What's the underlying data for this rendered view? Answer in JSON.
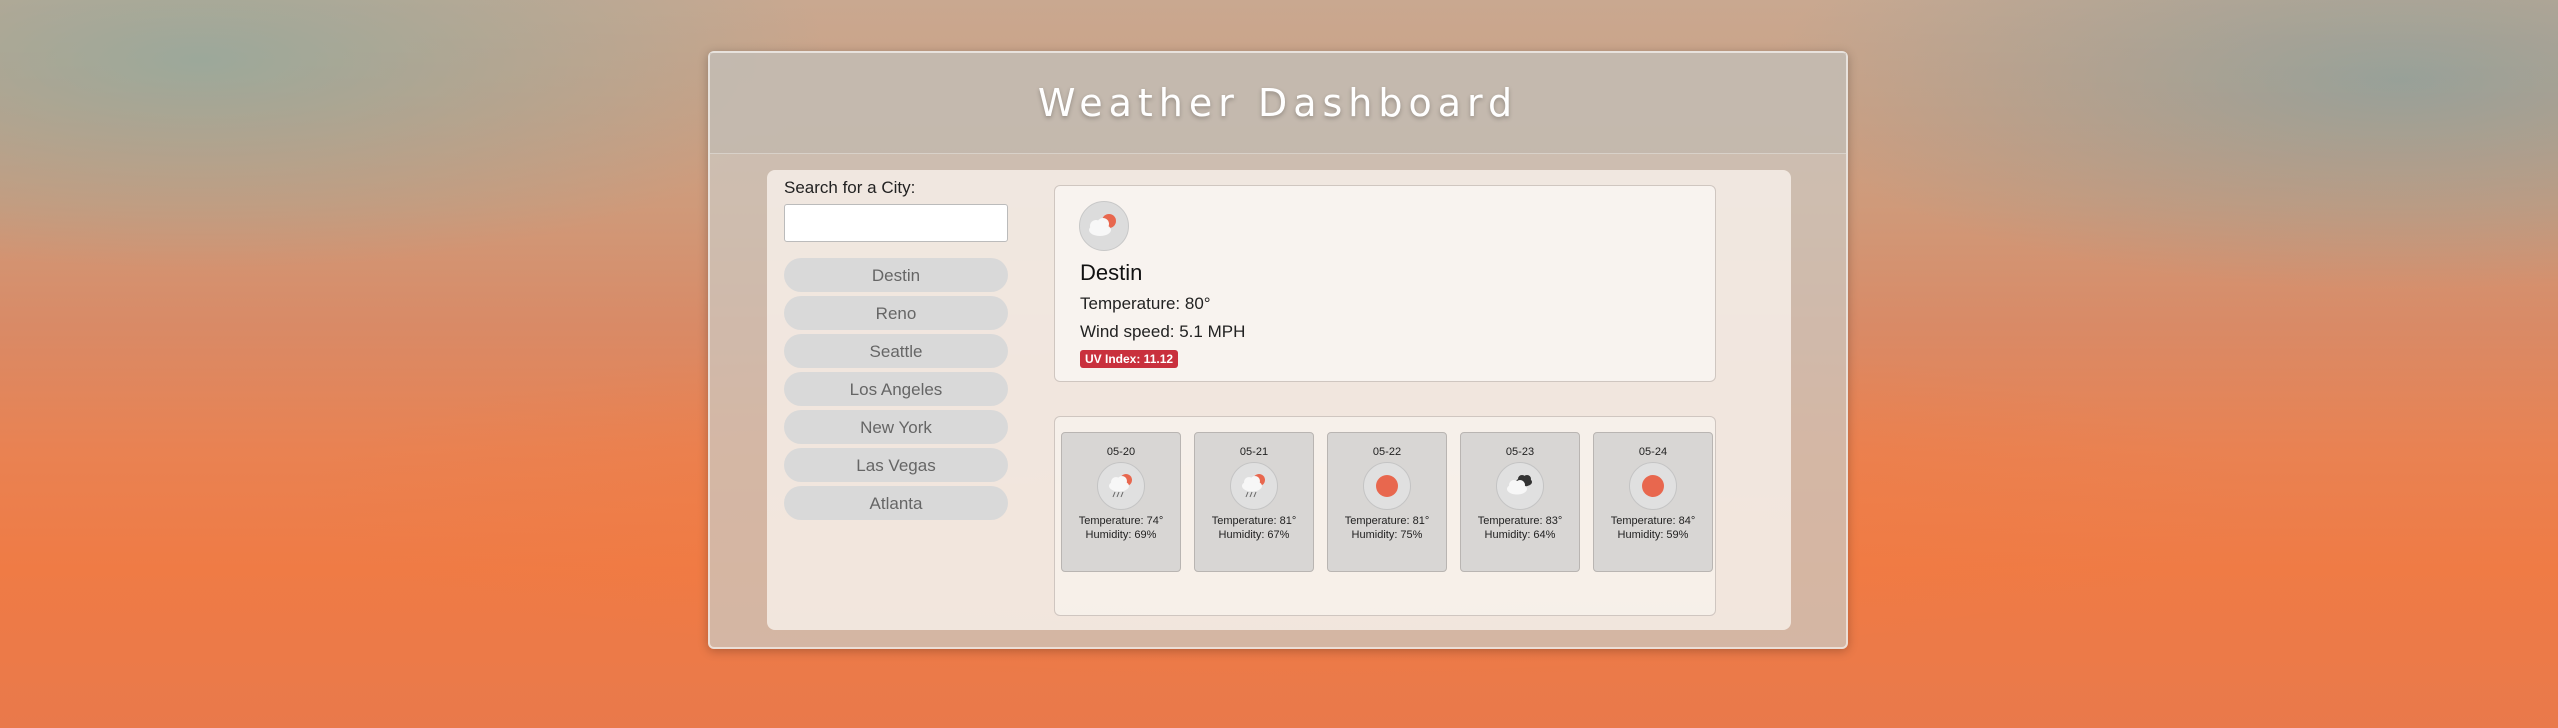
{
  "app": {
    "title": "Weather Dashboard"
  },
  "search": {
    "label": "Search for a City:",
    "value": "",
    "placeholder": ""
  },
  "cities": [
    "Destin",
    "Reno",
    "Seattle",
    "Los Angeles",
    "New York",
    "Las Vegas",
    "Atlanta"
  ],
  "current": {
    "icon": "partly-cloudy-sun-icon",
    "city": "Destin",
    "temperature": "Temperature: 80°",
    "wind": "Wind speed: 5.1 MPH",
    "uv": "UV Index: 11.12",
    "uv_color": "#c9303d"
  },
  "forecast": [
    {
      "date": "05-20",
      "icon": "rain-sun-icon",
      "temperature": "Temperature: 74°",
      "humidity": "Humidity: 69%"
    },
    {
      "date": "05-21",
      "icon": "rain-sun-icon",
      "temperature": "Temperature: 81°",
      "humidity": "Humidity: 67%"
    },
    {
      "date": "05-22",
      "icon": "sun-icon",
      "temperature": "Temperature: 81°",
      "humidity": "Humidity: 75%"
    },
    {
      "date": "05-23",
      "icon": "broken-clouds-icon",
      "temperature": "Temperature: 83°",
      "humidity": "Humidity: 64%"
    },
    {
      "date": "05-24",
      "icon": "sun-icon",
      "temperature": "Temperature: 84°",
      "humidity": "Humidity: 59%"
    }
  ],
  "colors": {
    "sun": "#e8674e",
    "cloud": "#f5f5f5",
    "dark_cloud": "#333333"
  }
}
